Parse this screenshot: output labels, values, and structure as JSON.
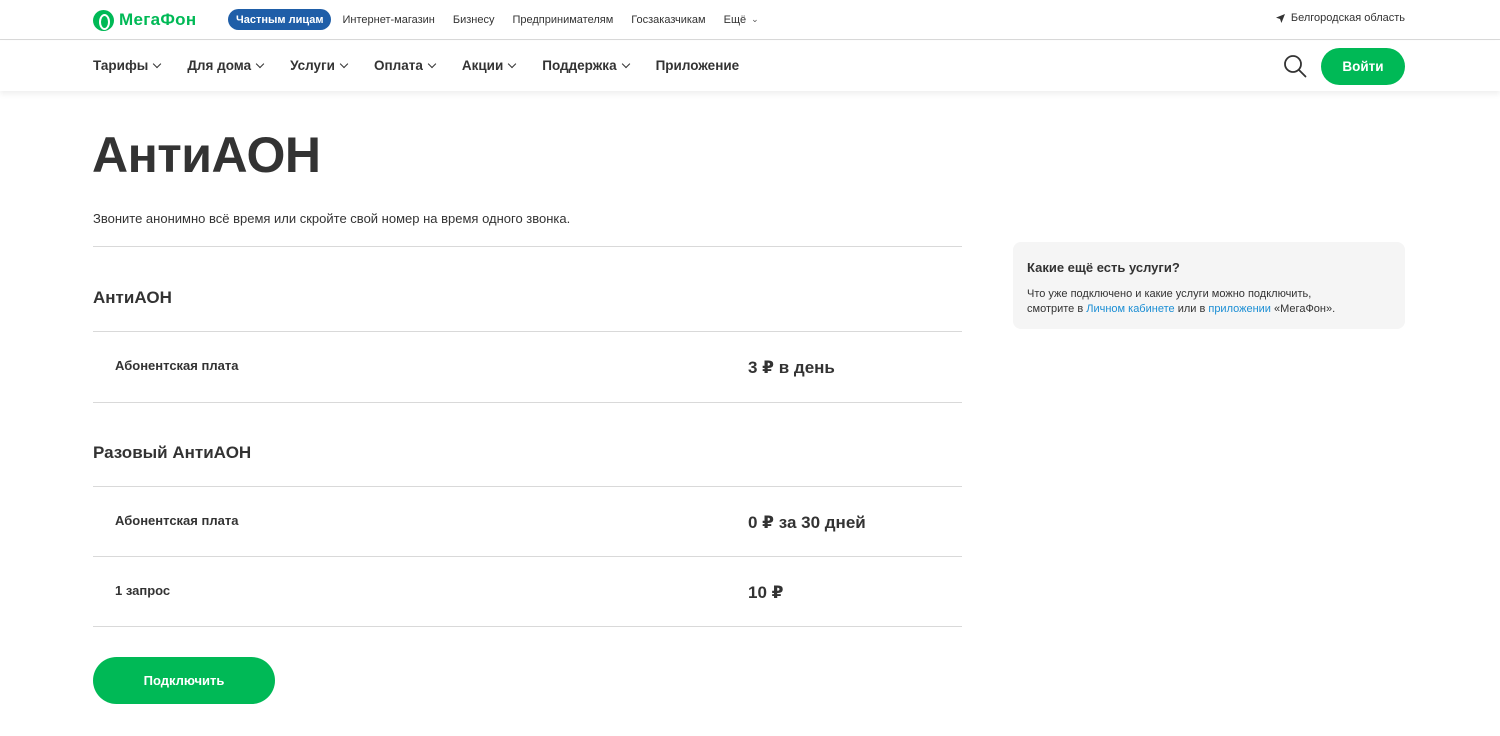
{
  "brand": {
    "name": "МегаФон",
    "accent": "#00b956",
    "segment_active_color": "#1f5ea8",
    "link_color": "#1b8ed4"
  },
  "topbar": {
    "segments": [
      {
        "label": "Частным лицам",
        "active": true
      },
      {
        "label": "Интернет-магазин"
      },
      {
        "label": "Бизнесу"
      },
      {
        "label": "Предпринимателям"
      },
      {
        "label": "Госзаказчикам"
      },
      {
        "label": "Ещё",
        "dropdown": true
      }
    ],
    "region": "Белгородская область",
    "region_icon": "location-arrow-icon"
  },
  "mainnav": {
    "items": [
      {
        "label": "Тарифы",
        "dropdown": true
      },
      {
        "label": "Для дома",
        "dropdown": true
      },
      {
        "label": "Услуги",
        "dropdown": true
      },
      {
        "label": "Оплата",
        "dropdown": true
      },
      {
        "label": "Акции",
        "dropdown": true
      },
      {
        "label": "Поддержка",
        "dropdown": true
      },
      {
        "label": "Приложение",
        "dropdown": false
      }
    ],
    "search_icon": "search-icon",
    "login_label": "Войти"
  },
  "page": {
    "title": "АнтиАОН",
    "subtitle": "Звоните анонимно всё время или скройте свой номер на время одного звонка."
  },
  "sections": [
    {
      "title": "АнтиАОН",
      "rows": [
        {
          "label": "Абонентская плата",
          "value": "3 ₽ в день"
        }
      ]
    },
    {
      "title": "Разовый АнтиАОН",
      "rows": [
        {
          "label": "Абонентская плата",
          "value": "0 ₽ за 30 дней"
        },
        {
          "label": "1 запрос",
          "value": "10 ₽"
        }
      ]
    }
  ],
  "connect_label": "Подключить",
  "side_card": {
    "title": "Какие ещё есть услуги?",
    "text_1": "Что уже подключено и какие услуги можно подключить,",
    "text_2": "смотрите в",
    "link_1": "Личном кабинете",
    "text_3": "или в",
    "link_2": "приложении",
    "text_4": "«МегаФон»."
  }
}
